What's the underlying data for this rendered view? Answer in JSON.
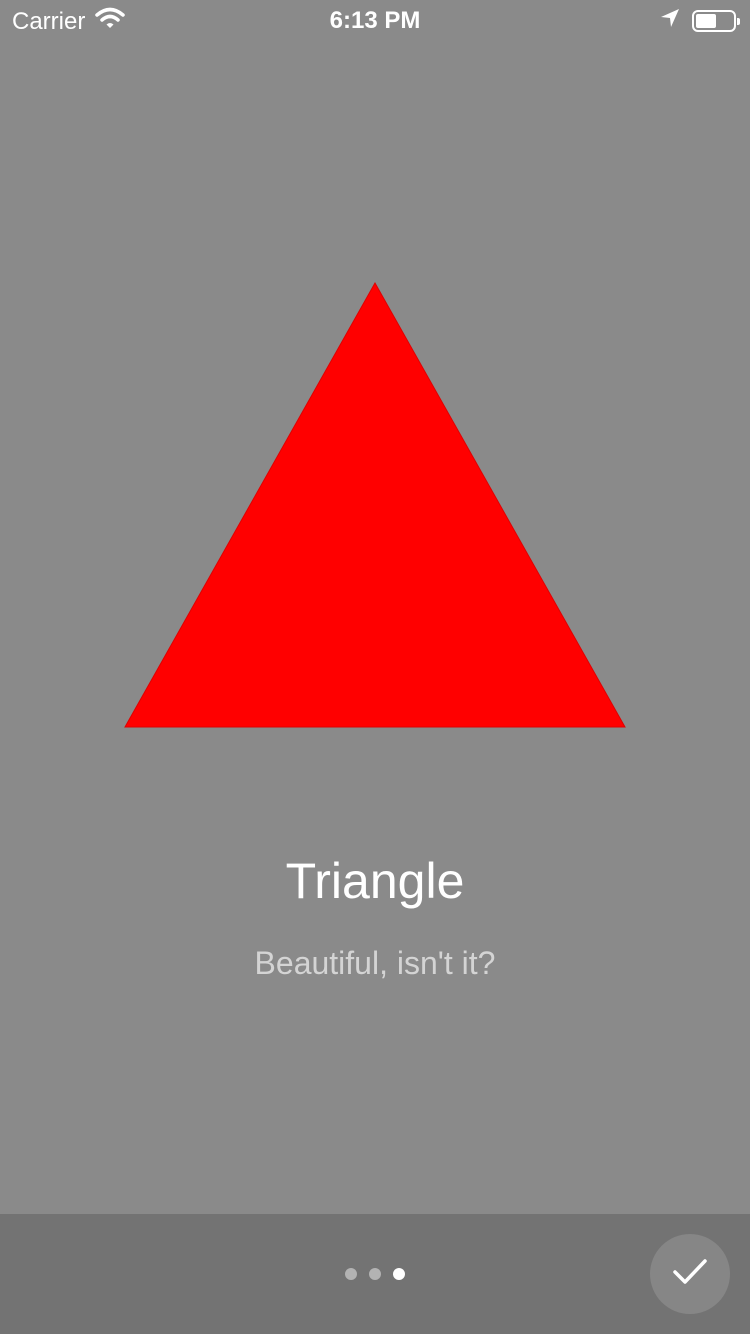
{
  "status_bar": {
    "carrier": "Carrier",
    "time": "6:13 PM",
    "battery_level": 0.55,
    "icons": [
      "wifi-icon",
      "location-arrow-icon",
      "battery-icon"
    ]
  },
  "page": {
    "shape": "triangle",
    "shape_color": "#ff0000",
    "title": "Triangle",
    "subtitle": "Beautiful, isn't it?"
  },
  "pager": {
    "count": 3,
    "active_index": 2
  },
  "done_button": {
    "icon": "checkmark-icon"
  },
  "colors": {
    "background": "#8a8a8a",
    "bottom_bar": "#737373",
    "accent": "#ffffff"
  }
}
